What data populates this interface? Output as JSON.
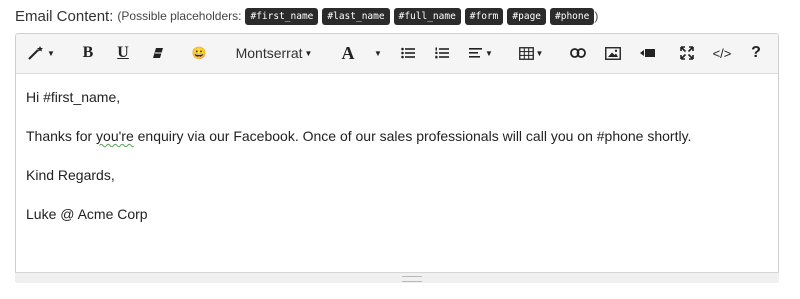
{
  "label": {
    "title": "Email Content:",
    "placeholders_prefix": "(Possible placeholders:",
    "placeholders_suffix": ")",
    "placeholders": [
      "#first_name",
      "#last_name",
      "#full_name",
      "#form",
      "#page",
      "#phone"
    ]
  },
  "toolbar": {
    "font_name": "Montserrat",
    "bold": "B",
    "underline": "U",
    "font_size_glyph": "A",
    "emoji": "😀",
    "code": "</>",
    "help": "?",
    "icons": [
      "magic-wand-icon",
      "bold-icon",
      "underline-icon",
      "eraser-icon",
      "emoji-icon",
      "font-family-select",
      "font-color-icon",
      "bullet-list-icon",
      "numbered-list-icon",
      "align-icon",
      "table-icon",
      "link-icon",
      "image-icon",
      "video-icon",
      "fullscreen-icon",
      "code-view-icon",
      "help-icon"
    ]
  },
  "content": {
    "line1": "Hi #first_name,",
    "line2_a": "Thanks for ",
    "line2_misspelled": "you're",
    "line2_b": " enquiry via our Facebook. Once of our sales professionals will call you on #phone shortly.",
    "line3": "Kind Regards,",
    "line4": "Luke @ Acme Corp"
  },
  "colors": {
    "chip_bg": "#2b2b2b",
    "toolbar_bg": "#f5f5f5",
    "spellcheck": "#5aa05a"
  }
}
